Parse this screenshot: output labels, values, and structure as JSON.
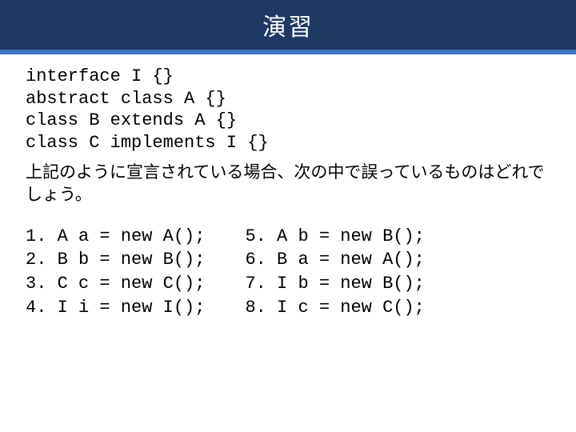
{
  "title": "演習",
  "declarations": "interface I {}\nabstract class A {}\nclass B extends A {}\nclass C implements I {}",
  "question": "上記のように宣言されている場合、次の中で誤っているものはどれでしょう。",
  "options_left": "1. A a = new A();\n2. B b = new B();\n3. C c = new C();\n4. I i = new I();",
  "options_right": "5. A b = new B();\n6. B a = new A();\n7. I b = new B();\n8. I c = new C();"
}
